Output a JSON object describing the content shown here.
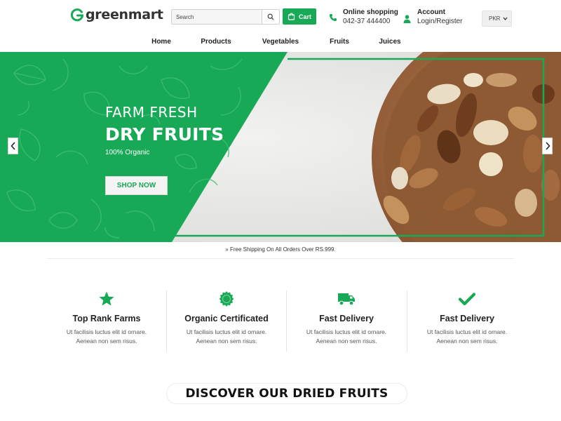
{
  "brand": {
    "name": "greenmart",
    "color": "#18a957"
  },
  "search": {
    "placeholder": "Search"
  },
  "cart": {
    "label": "Cart"
  },
  "contact": {
    "title": "Online shopping",
    "phone": "042-37 444400"
  },
  "account": {
    "title": "Account",
    "links": "Login/Register"
  },
  "currency": {
    "selected": "PKR"
  },
  "nav": {
    "items": [
      {
        "label": "Home"
      },
      {
        "label": "Products"
      },
      {
        "label": "Vegetables"
      },
      {
        "label": "Fruits"
      },
      {
        "label": "Juices"
      }
    ]
  },
  "hero": {
    "tagline": "FARM FRESH",
    "title": "DRY FRUITS",
    "subtitle": "100% Organic",
    "cta": "SHOP NOW"
  },
  "shipping": {
    "text": "» Free Shipping On All Orders Over RS.999."
  },
  "features": [
    {
      "icon": "star-icon",
      "title": "Top Rank Farms",
      "line1": "Ut facilisis luctus elit id ornare.",
      "line2": "Aenean non sem risus."
    },
    {
      "icon": "certificate-badge-icon",
      "title": "Organic Certificated",
      "line1": "Ut facilisis luctus elit id ornare.",
      "line2": "Aenean non sem risus."
    },
    {
      "icon": "truck-icon",
      "title": "Fast Delivery",
      "line1": "Ut facilisis luctus elit id ornare.",
      "line2": "Aenean non sem risus."
    },
    {
      "icon": "checkmark-icon",
      "title": "Fast Delivery",
      "line1": "Ut facilisis luctus elit id ornare.",
      "line2": "Aenean non sem risus."
    }
  ],
  "discover": {
    "title": "DISCOVER OUR DRIED FRUITS"
  }
}
